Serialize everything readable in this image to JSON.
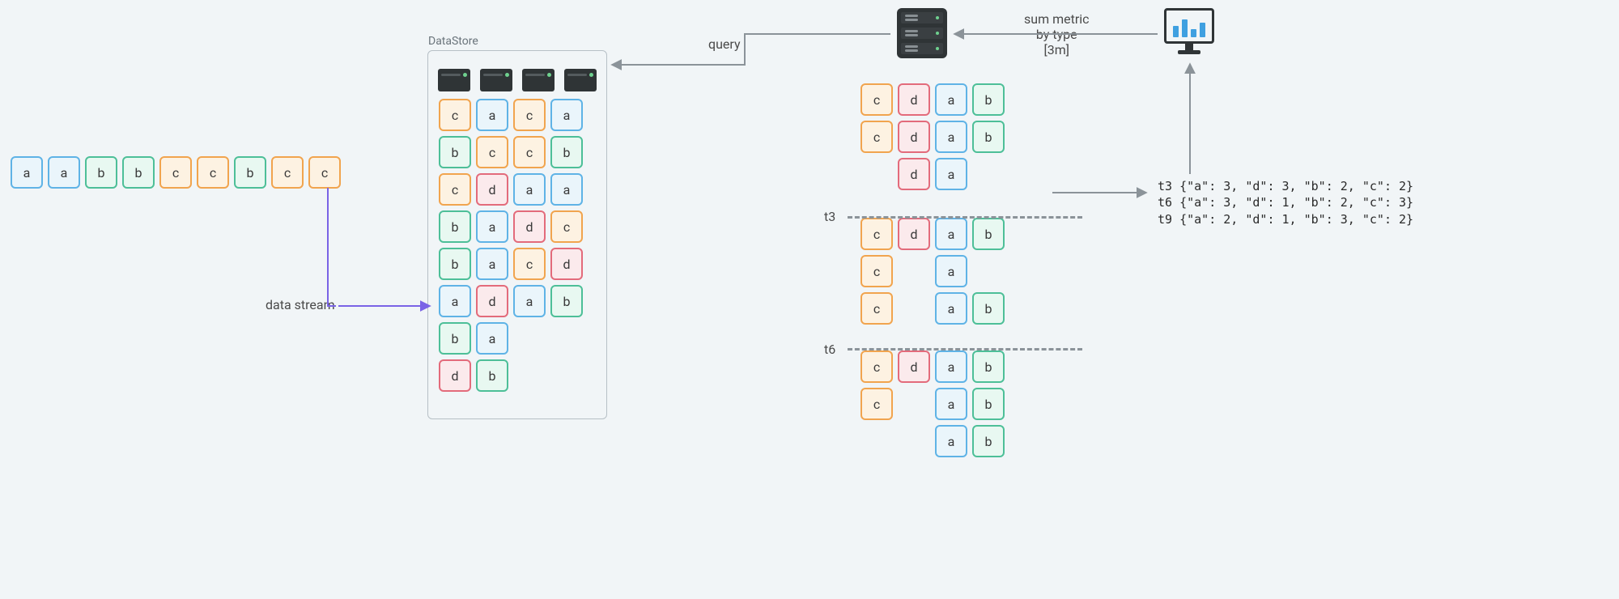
{
  "colors": {
    "a": "#5fb3e6",
    "b": "#4dbf98",
    "c": "#f1a44e",
    "d": "#e36b7b"
  },
  "labels": {
    "datastore": "DataStore",
    "data_stream": "data stream",
    "query": "query",
    "sum_metric": "sum metric\nby type\n[3m]",
    "t3": "t3",
    "t6": "t6"
  },
  "stream": [
    "a",
    "a",
    "b",
    "b",
    "c",
    "c",
    "b",
    "c",
    "c"
  ],
  "datastore_rows": [
    [
      "c",
      "a",
      "c",
      "a"
    ],
    [
      "b",
      "c",
      "c",
      "b"
    ],
    [
      "c",
      "d",
      "a",
      "a"
    ],
    [
      "b",
      "a",
      "d",
      "c"
    ],
    [
      "b",
      "a",
      "c",
      "d"
    ],
    [
      "a",
      "d",
      "a",
      "b"
    ],
    [
      "b",
      "a",
      null,
      null
    ],
    [
      "d",
      "b",
      null,
      null
    ]
  ],
  "groups": {
    "top": [
      [
        "c",
        "d",
        "a",
        "b"
      ],
      [
        "c",
        "d",
        "a",
        "b"
      ],
      [
        null,
        "d",
        "a",
        null
      ]
    ],
    "mid": [
      [
        "c",
        "d",
        "a",
        "b"
      ],
      [
        "c",
        null,
        "a",
        null
      ],
      [
        "c",
        null,
        "a",
        "b"
      ]
    ],
    "bot": [
      [
        "c",
        "d",
        "a",
        "b"
      ],
      [
        "c",
        null,
        "a",
        "b"
      ],
      [
        null,
        null,
        "a",
        "b"
      ]
    ]
  },
  "results": [
    "t3 {\"a\": 3, \"d\": 3, \"b\": 2, \"c\": 2}",
    "t6 {\"a\": 3, \"d\": 1, \"b\": 2, \"c\": 3}",
    "t9 {\"a\": 2, \"d\": 1, \"b\": 3, \"c\": 2}"
  ]
}
